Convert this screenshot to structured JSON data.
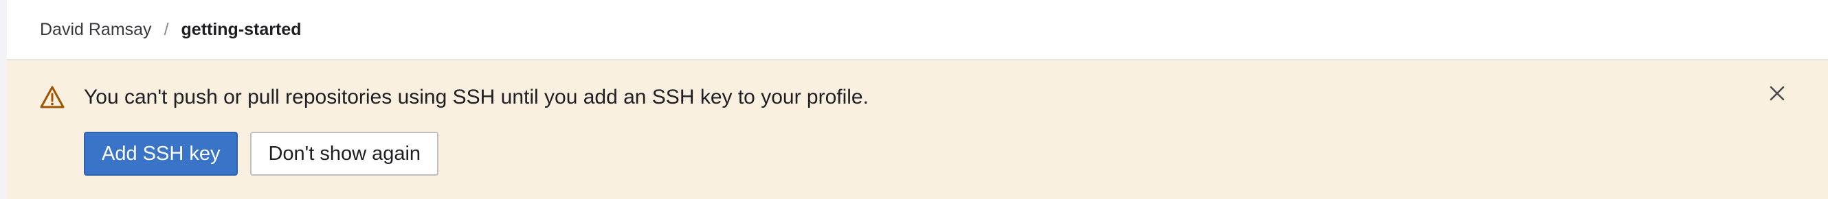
{
  "breadcrumb": {
    "owner": "David Ramsay",
    "separator": "/",
    "current": "getting-started"
  },
  "alert": {
    "icon": "warning-icon",
    "message": "You can't push or pull repositories using SSH until you add an SSH key to your profile.",
    "close_icon": "close-icon",
    "primary_label": "Add SSH key",
    "secondary_label": "Don't show again"
  },
  "colors": {
    "alert_background": "#f9f0df",
    "warning_icon": "#9e5400",
    "primary_button": "#3a74c9"
  }
}
